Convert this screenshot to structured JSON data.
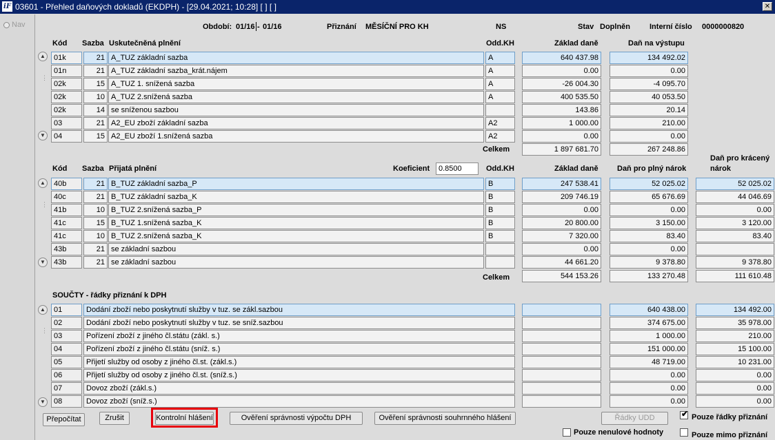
{
  "window": {
    "logo_text": "iF",
    "title": "03601 - Přehled daňových dokladů (EKDPH) - [29.04.2021; 10:28]  [ ]  [ ]",
    "btn_close": "✕"
  },
  "nav": {
    "label": "Nav"
  },
  "header": {
    "period_label": "Období:",
    "period_from": "01/16",
    "period_sep": "-",
    "period_to": "01/16",
    "submission_label": "Přiznání",
    "submission_value": "MĚSÍČNÍ PRO KH",
    "ns_label": "NS",
    "state_label": "Stav",
    "state_value": "Doplněn",
    "internal_label": "Interní číslo",
    "internal_value": "0000000820"
  },
  "output_section": {
    "col_code": "Kód",
    "col_rate": "Sazba",
    "col_title": "Uskutečněná plnění",
    "col_kh": "Odd.KH",
    "col_base": "Základ daně",
    "col_tax": "Daň na výstupu",
    "rows": [
      {
        "code": "01k",
        "rate": "21",
        "desc": "A_TUZ základní sazba",
        "kh": "A",
        "base": "640 437.98",
        "tax": "134 492.02"
      },
      {
        "code": "01n",
        "rate": "21",
        "desc": "A_TUZ základní sazba_krát.nájem",
        "kh": "A",
        "base": "0.00",
        "tax": "0.00"
      },
      {
        "code": "02k",
        "rate": "15",
        "desc": "A_TUZ 1. snížená sazba",
        "kh": "A",
        "base": "-26 004.30",
        "tax": "-4 095.70"
      },
      {
        "code": "02k",
        "rate": "10",
        "desc": "A_TUZ 2.snížená sazba",
        "kh": "A",
        "base": "400 535.50",
        "tax": "40 053.50"
      },
      {
        "code": "02k",
        "rate": "14",
        "desc": "se sníženou sazbou",
        "kh": "",
        "base": "143.86",
        "tax": "20.14"
      },
      {
        "code": "03",
        "rate": "21",
        "desc": "A2_EU zboží základní sazba",
        "kh": "A2",
        "base": "1 000.00",
        "tax": "210.00"
      },
      {
        "code": "04",
        "rate": "15",
        "desc": "A2_EU zboží 1.snížená sazba",
        "kh": "A2",
        "base": "0.00",
        "tax": "0.00"
      }
    ],
    "total_label": "Celkem",
    "total_base": "1 897 681.70",
    "total_tax": "267 248.86"
  },
  "input_section": {
    "col_code": "Kód",
    "col_rate": "Sazba",
    "col_title": "Přijatá plnění",
    "coef_label": "Koeficient",
    "coef_value": "0.8500",
    "col_kh": "Odd.KH",
    "col_base": "Základ daně",
    "col_full": "Daň pro plný nárok",
    "col_reduced_1": "Daň pro krácený",
    "col_reduced_2": "nárok",
    "rows": [
      {
        "code": "40b",
        "rate": "21",
        "desc": "B_TUZ základní sazba_P",
        "kh": "B",
        "base": "247 538.41",
        "full": "52 025.02",
        "reduced": "52 025.02"
      },
      {
        "code": "40c",
        "rate": "21",
        "desc": "B_TUZ základní sazba_K",
        "kh": "B",
        "base": "209 746.19",
        "full": "65 676.69",
        "reduced": "44 046.69"
      },
      {
        "code": "41b",
        "rate": "10",
        "desc": "B_TUZ 2.snížená sazba_P",
        "kh": "B",
        "base": "0.00",
        "full": "0.00",
        "reduced": "0.00"
      },
      {
        "code": "41c",
        "rate": "15",
        "desc": "B_TUZ 1.snížená sazba_K",
        "kh": "B",
        "base": "20 800.00",
        "full": "3 150.00",
        "reduced": "3 120.00"
      },
      {
        "code": "41c",
        "rate": "10",
        "desc": "B_TUZ 2.snížená sazba_K",
        "kh": "B",
        "base": "7 320.00",
        "full": "83.40",
        "reduced": "83.40"
      },
      {
        "code": "43b",
        "rate": "21",
        "desc": "se základní sazbou",
        "kh": "",
        "base": "0.00",
        "full": "0.00",
        "reduced": ""
      },
      {
        "code": "43b",
        "rate": "21",
        "desc": "se základní sazbou",
        "kh": "",
        "base": "44 661.20",
        "full": "9 378.80",
        "reduced": "9 378.80"
      }
    ],
    "total_label": "Celkem",
    "total_base": "544 153.26",
    "total_full": "133 270.48",
    "total_reduced": "111 610.48"
  },
  "sum_section": {
    "title": "SOUČTY - řádky přiznání k DPH",
    "rows": [
      {
        "code": "01",
        "desc": "Dodání zboží nebo poskytnutí služby v tuz. se zákl.sazbou",
        "base": "640 438.00",
        "tax": "134 492.00"
      },
      {
        "code": "02",
        "desc": "Dodání zboží nebo poskytnutí služby v tuz. se sníž.sazbou",
        "base": "374 675.00",
        "tax": "35 978.00"
      },
      {
        "code": "03",
        "desc": "Pořízení zboží z jiného čl.státu (zákl. s.)",
        "base": "1 000.00",
        "tax": "210.00"
      },
      {
        "code": "04",
        "desc": "Pořízení zboží z jiného čl.státu (sníž. s.)",
        "base": "151 000.00",
        "tax": "15 100.00"
      },
      {
        "code": "05",
        "desc": "Přijetí služby od osoby z jiného čl.st. (zákl.s.)",
        "base": "48 719.00",
        "tax": "10 231.00"
      },
      {
        "code": "06",
        "desc": "Přijetí služby od osoby z jiného čl.st. (sníž.s.)",
        "base": "0.00",
        "tax": "0.00"
      },
      {
        "code": "07",
        "desc": "Dovoz zboží (zákl.s.)",
        "base": "0.00",
        "tax": "0.00"
      },
      {
        "code": "08",
        "desc": "Dovoz zboží (sníž.s.)",
        "base": "0.00",
        "tax": "0.00"
      }
    ]
  },
  "buttons": {
    "recalc": "Přepočítat",
    "cancel": "Zrušit",
    "control": "Kontrolní hlášení",
    "verify_calc": "Ověření správnosti výpočtu DPH",
    "verify_summary": "Ověření správnosti souhrnného hlášení",
    "udd": "Řádky UDD"
  },
  "checkboxes": {
    "only_rows": "Pouze řádky přiznání",
    "only_nonzero": "Pouze nenulové hodnoty",
    "only_outside": "Pouze mimo přiznání"
  },
  "icons": {
    "up": "▲",
    "down": "▼",
    "grip": "⋮",
    "check": "✔"
  }
}
